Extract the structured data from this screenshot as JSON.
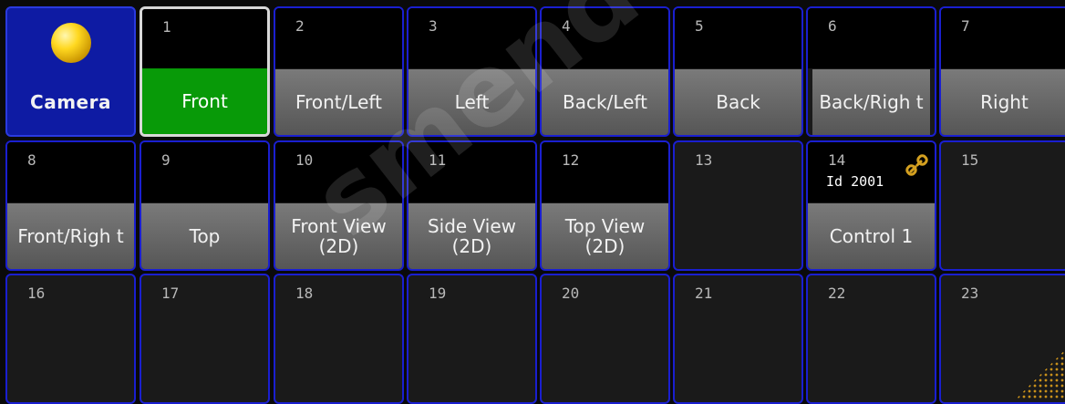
{
  "title_button": {
    "label": "Camera",
    "icon": "camera-sphere-icon"
  },
  "pool": [
    {
      "num": "1",
      "label": "Front",
      "state": "active"
    },
    {
      "num": "2",
      "label": "Front/Left",
      "state": "filled"
    },
    {
      "num": "3",
      "label": "Left",
      "state": "filled"
    },
    {
      "num": "4",
      "label": "Back/Left",
      "state": "filled"
    },
    {
      "num": "5",
      "label": "Back",
      "state": "filled"
    },
    {
      "num": "6",
      "label": "Back/Righ t",
      "state": "filled"
    },
    {
      "num": "7",
      "label": "Right",
      "state": "filled"
    },
    {
      "num": "8",
      "label": "Front/Righ t",
      "state": "filled"
    },
    {
      "num": "9",
      "label": "Top",
      "state": "filled"
    },
    {
      "num": "10",
      "label": "Front View (2D)",
      "state": "filled"
    },
    {
      "num": "11",
      "label": "Side View (2D)",
      "state": "filled"
    },
    {
      "num": "12",
      "label": "Top View (2D)",
      "state": "filled"
    },
    {
      "num": "13",
      "label": "",
      "state": "empty"
    },
    {
      "num": "14",
      "label": "Control 1",
      "id_text": "Id 2001",
      "state": "linked"
    },
    {
      "num": "15",
      "label": "",
      "state": "empty"
    },
    {
      "num": "16",
      "label": "",
      "state": "empty"
    },
    {
      "num": "17",
      "label": "",
      "state": "empty"
    },
    {
      "num": "18",
      "label": "",
      "state": "empty"
    },
    {
      "num": "19",
      "label": "",
      "state": "empty"
    },
    {
      "num": "20",
      "label": "",
      "state": "empty"
    },
    {
      "num": "21",
      "label": "",
      "state": "empty"
    },
    {
      "num": "22",
      "label": "",
      "state": "empty"
    },
    {
      "num": "23",
      "label": "",
      "state": "empty"
    }
  ],
  "watermark": {
    "text": "smendoza"
  },
  "colors": {
    "border": "#1a1fd0",
    "title_bg": "#0e1ba3",
    "active_label": "#089a08",
    "label_gray": "#666666",
    "link_gold": "#d4a020"
  }
}
